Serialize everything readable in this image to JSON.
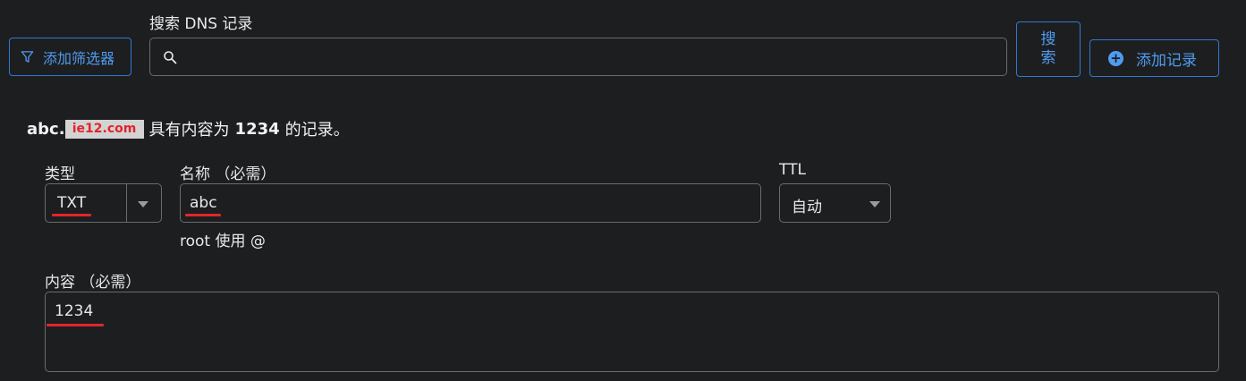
{
  "toolbar": {
    "filter_button": "添加筛选器",
    "search_label": "搜索 DNS 记录",
    "search_placeholder": "",
    "search_button_line1": "搜",
    "search_button_line2": "索",
    "add_button": "添加记录"
  },
  "summary": {
    "name_prefix": "abc.",
    "watermark": "ie12.com",
    "text_middle": "具有内容为",
    "content_value": "1234",
    "text_end": "的记录。"
  },
  "form": {
    "type_label": "类型",
    "type_value": "TXT",
    "name_label": "名称 （必需）",
    "name_value": "abc",
    "name_hint": "root 使用 @",
    "ttl_label": "TTL",
    "ttl_value": "自动",
    "content_label": "内容 （必需）",
    "content_value": "1234"
  },
  "colors": {
    "background": "#1d1e20",
    "accent": "#2e78d6",
    "highlight": "#e0262b"
  }
}
